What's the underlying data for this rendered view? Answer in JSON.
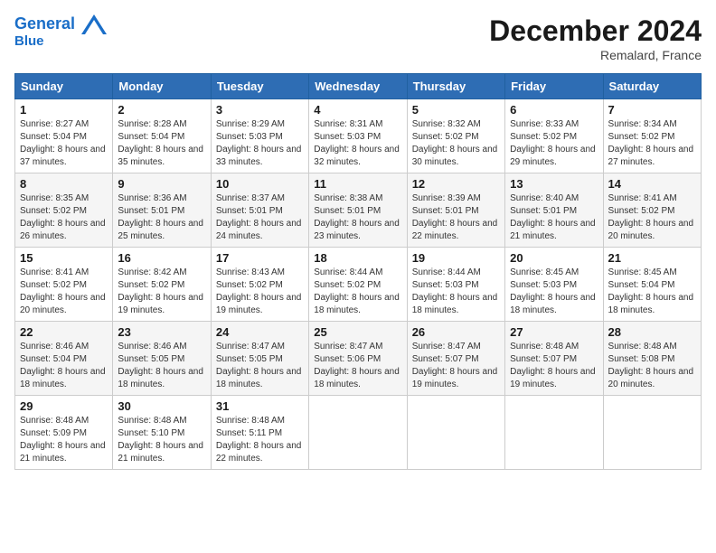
{
  "header": {
    "logo_line1": "General",
    "logo_line2": "Blue",
    "month_title": "December 2024",
    "subtitle": "Remalard, France"
  },
  "weekdays": [
    "Sunday",
    "Monday",
    "Tuesday",
    "Wednesday",
    "Thursday",
    "Friday",
    "Saturday"
  ],
  "weeks": [
    [
      {
        "day": "1",
        "info": "Sunrise: 8:27 AM\nSunset: 5:04 PM\nDaylight: 8 hours and 37 minutes."
      },
      {
        "day": "2",
        "info": "Sunrise: 8:28 AM\nSunset: 5:04 PM\nDaylight: 8 hours and 35 minutes."
      },
      {
        "day": "3",
        "info": "Sunrise: 8:29 AM\nSunset: 5:03 PM\nDaylight: 8 hours and 33 minutes."
      },
      {
        "day": "4",
        "info": "Sunrise: 8:31 AM\nSunset: 5:03 PM\nDaylight: 8 hours and 32 minutes."
      },
      {
        "day": "5",
        "info": "Sunrise: 8:32 AM\nSunset: 5:02 PM\nDaylight: 8 hours and 30 minutes."
      },
      {
        "day": "6",
        "info": "Sunrise: 8:33 AM\nSunset: 5:02 PM\nDaylight: 8 hours and 29 minutes."
      },
      {
        "day": "7",
        "info": "Sunrise: 8:34 AM\nSunset: 5:02 PM\nDaylight: 8 hours and 27 minutes."
      }
    ],
    [
      {
        "day": "8",
        "info": "Sunrise: 8:35 AM\nSunset: 5:02 PM\nDaylight: 8 hours and 26 minutes."
      },
      {
        "day": "9",
        "info": "Sunrise: 8:36 AM\nSunset: 5:01 PM\nDaylight: 8 hours and 25 minutes."
      },
      {
        "day": "10",
        "info": "Sunrise: 8:37 AM\nSunset: 5:01 PM\nDaylight: 8 hours and 24 minutes."
      },
      {
        "day": "11",
        "info": "Sunrise: 8:38 AM\nSunset: 5:01 PM\nDaylight: 8 hours and 23 minutes."
      },
      {
        "day": "12",
        "info": "Sunrise: 8:39 AM\nSunset: 5:01 PM\nDaylight: 8 hours and 22 minutes."
      },
      {
        "day": "13",
        "info": "Sunrise: 8:40 AM\nSunset: 5:01 PM\nDaylight: 8 hours and 21 minutes."
      },
      {
        "day": "14",
        "info": "Sunrise: 8:41 AM\nSunset: 5:02 PM\nDaylight: 8 hours and 20 minutes."
      }
    ],
    [
      {
        "day": "15",
        "info": "Sunrise: 8:41 AM\nSunset: 5:02 PM\nDaylight: 8 hours and 20 minutes."
      },
      {
        "day": "16",
        "info": "Sunrise: 8:42 AM\nSunset: 5:02 PM\nDaylight: 8 hours and 19 minutes."
      },
      {
        "day": "17",
        "info": "Sunrise: 8:43 AM\nSunset: 5:02 PM\nDaylight: 8 hours and 19 minutes."
      },
      {
        "day": "18",
        "info": "Sunrise: 8:44 AM\nSunset: 5:02 PM\nDaylight: 8 hours and 18 minutes."
      },
      {
        "day": "19",
        "info": "Sunrise: 8:44 AM\nSunset: 5:03 PM\nDaylight: 8 hours and 18 minutes."
      },
      {
        "day": "20",
        "info": "Sunrise: 8:45 AM\nSunset: 5:03 PM\nDaylight: 8 hours and 18 minutes."
      },
      {
        "day": "21",
        "info": "Sunrise: 8:45 AM\nSunset: 5:04 PM\nDaylight: 8 hours and 18 minutes."
      }
    ],
    [
      {
        "day": "22",
        "info": "Sunrise: 8:46 AM\nSunset: 5:04 PM\nDaylight: 8 hours and 18 minutes."
      },
      {
        "day": "23",
        "info": "Sunrise: 8:46 AM\nSunset: 5:05 PM\nDaylight: 8 hours and 18 minutes."
      },
      {
        "day": "24",
        "info": "Sunrise: 8:47 AM\nSunset: 5:05 PM\nDaylight: 8 hours and 18 minutes."
      },
      {
        "day": "25",
        "info": "Sunrise: 8:47 AM\nSunset: 5:06 PM\nDaylight: 8 hours and 18 minutes."
      },
      {
        "day": "26",
        "info": "Sunrise: 8:47 AM\nSunset: 5:07 PM\nDaylight: 8 hours and 19 minutes."
      },
      {
        "day": "27",
        "info": "Sunrise: 8:48 AM\nSunset: 5:07 PM\nDaylight: 8 hours and 19 minutes."
      },
      {
        "day": "28",
        "info": "Sunrise: 8:48 AM\nSunset: 5:08 PM\nDaylight: 8 hours and 20 minutes."
      }
    ],
    [
      {
        "day": "29",
        "info": "Sunrise: 8:48 AM\nSunset: 5:09 PM\nDaylight: 8 hours and 21 minutes."
      },
      {
        "day": "30",
        "info": "Sunrise: 8:48 AM\nSunset: 5:10 PM\nDaylight: 8 hours and 21 minutes."
      },
      {
        "day": "31",
        "info": "Sunrise: 8:48 AM\nSunset: 5:11 PM\nDaylight: 8 hours and 22 minutes."
      },
      null,
      null,
      null,
      null
    ]
  ]
}
